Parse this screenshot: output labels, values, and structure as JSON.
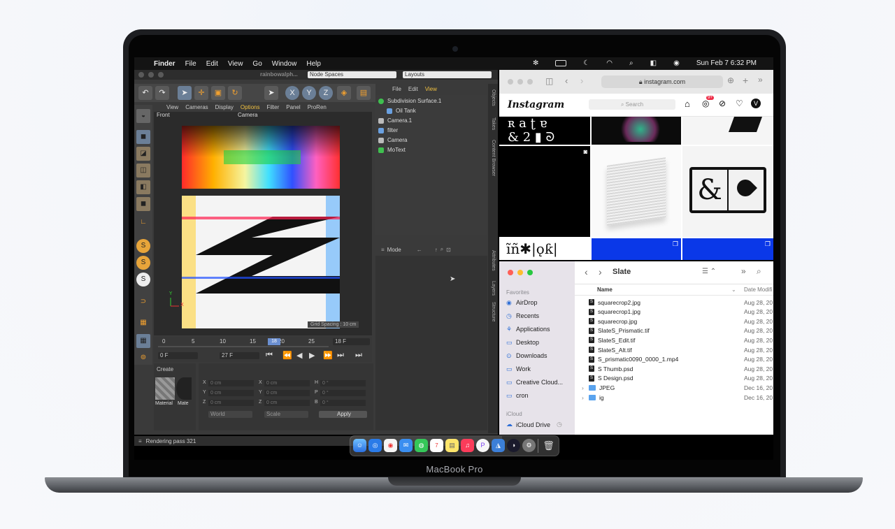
{
  "menubar": {
    "apple": "",
    "app": "Finder",
    "items": [
      "File",
      "Edit",
      "View",
      "Go",
      "Window",
      "Help"
    ],
    "clock": "Sun Feb 7  6:32 PM"
  },
  "c4d": {
    "doc_title": "rainbowalph...",
    "node_spaces": "Node Spaces",
    "layouts": "Layouts",
    "viewport_menu": [
      "View",
      "Cameras",
      "Display",
      "Options",
      "Filter",
      "Panel",
      "ProRen"
    ],
    "viewport_label": "Front",
    "camera_label": "Camera",
    "grid_spacing": "Grid Spacing : 10 cm",
    "obj_menu": [
      "File",
      "Edit",
      "View"
    ],
    "objects": [
      "Subdivision Surface.1",
      "Oil Tank",
      "Camera.1",
      "filter",
      "Camera",
      "MoText"
    ],
    "attr_mode": "Mode",
    "vtabs": [
      "Objects",
      "Takes",
      "Content Browser",
      "Attributes",
      "Layers",
      "Structure"
    ],
    "ruler_ticks": [
      "0",
      "5",
      "10",
      "15",
      "20",
      "25"
    ],
    "ruler_current": "18",
    "frame_end_display": "18 F",
    "frame_start": "0 F",
    "frame_max": "27 F",
    "create": "Create",
    "materials": [
      "Material",
      "Mate"
    ],
    "coord_labels": [
      "X",
      "Y",
      "Z",
      "X",
      "Y",
      "Z",
      "H",
      "P",
      "B"
    ],
    "coord_value": "0 cm",
    "coord_angle": "0 °",
    "world": "World",
    "scale": "Scale",
    "apply": "Apply",
    "status": "Rendering pass 321"
  },
  "safari": {
    "url": "instagram.com",
    "brand": "Instagram",
    "search_placeholder": "Search",
    "notif_badge": "9+"
  },
  "finder": {
    "folder": "Slate",
    "favorites_heading": "Favorites",
    "sidebar": [
      "AirDrop",
      "Recents",
      "Applications",
      "Desktop",
      "Downloads",
      "Work",
      "Creative Cloud...",
      "cron"
    ],
    "icloud_heading": "iCloud",
    "icloud_items": [
      "iCloud Drive"
    ],
    "col_name": "Name",
    "col_date": "Date Modifi",
    "files": [
      {
        "name": "squarecrop2.jpg",
        "date": "Aug 28, 20"
      },
      {
        "name": "squarecrop1.jpg",
        "date": "Aug 28, 20"
      },
      {
        "name": "squarecrop.jpg",
        "date": "Aug 28, 20"
      },
      {
        "name": "SlateS_Prismatic.tif",
        "date": "Aug 28, 20"
      },
      {
        "name": "SlateS_Edit.tif",
        "date": "Aug 28, 20"
      },
      {
        "name": "SlateS_Alt.tif",
        "date": "Aug 28, 20"
      },
      {
        "name": "S_prismatic0090_0000_1.mp4",
        "date": "Aug 28, 20"
      },
      {
        "name": "S Thumb.psd",
        "date": "Aug 28, 20"
      },
      {
        "name": "S Design.psd",
        "date": "Aug 28, 20"
      },
      {
        "name": "JPEG",
        "date": "Dec 16, 20"
      },
      {
        "name": "ig",
        "date": "Dec 16, 20"
      }
    ]
  },
  "laptop": {
    "model": "MacBook Pro"
  },
  "colors": {
    "c4d_bg": "#3a3a3a",
    "finder_accent": "#2f6fd6",
    "ig_blue": "#0a38e8"
  }
}
